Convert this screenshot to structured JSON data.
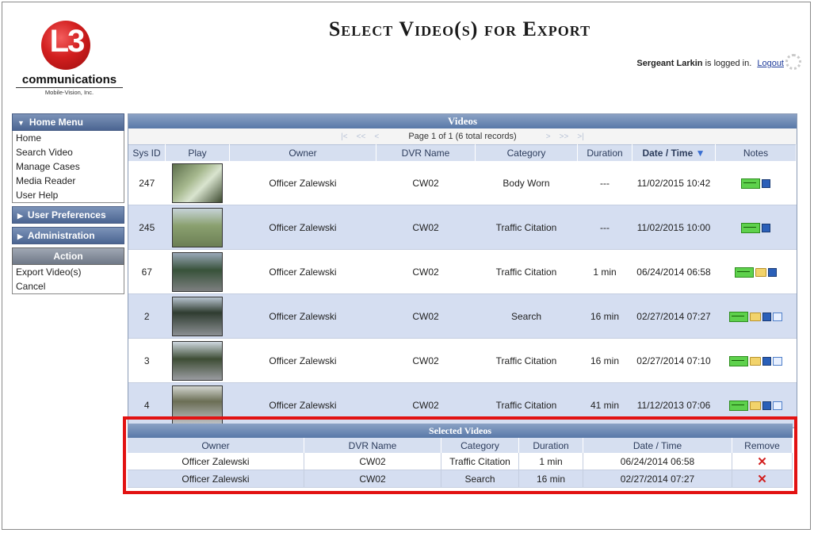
{
  "header": {
    "title": "Select Video(s) for Export",
    "user_name": "Sergeant Larkin",
    "logged_in_text": "is logged in.",
    "logout_label": "Logout"
  },
  "logo": {
    "mark": "L3",
    "name": "communications",
    "sub": "Mobile-Vision, Inc."
  },
  "sidebar": {
    "home_menu": "Home Menu",
    "items": [
      "Home",
      "Search Video",
      "Manage Cases",
      "Media Reader",
      "User Help"
    ],
    "user_preferences": "User Preferences",
    "administration": "Administration",
    "action": "Action",
    "actions": [
      "Export Video(s)",
      "Cancel"
    ]
  },
  "videos": {
    "title": "Videos",
    "pager_text": "Page 1 of 1 (6 total records)",
    "columns": [
      "Sys ID",
      "Play",
      "Owner",
      "DVR Name",
      "Category",
      "Duration",
      "Date / Time",
      "Notes"
    ],
    "sort_indicator": "▼",
    "rows": [
      {
        "sys_id": "247",
        "owner": "Officer Zalewski",
        "dvr": "CW02",
        "category": "Body Worn",
        "duration": "---",
        "datetime": "11/02/2015 10:42"
      },
      {
        "sys_id": "245",
        "owner": "Officer Zalewski",
        "dvr": "CW02",
        "category": "Traffic Citation",
        "duration": "---",
        "datetime": "11/02/2015 10:00"
      },
      {
        "sys_id": "67",
        "owner": "Officer Zalewski",
        "dvr": "CW02",
        "category": "Traffic Citation",
        "duration": "1 min",
        "datetime": "06/24/2014 06:58"
      },
      {
        "sys_id": "2",
        "owner": "Officer Zalewski",
        "dvr": "CW02",
        "category": "Search",
        "duration": "16 min",
        "datetime": "02/27/2014 07:27"
      },
      {
        "sys_id": "3",
        "owner": "Officer Zalewski",
        "dvr": "CW02",
        "category": "Traffic Citation",
        "duration": "16 min",
        "datetime": "02/27/2014 07:10"
      },
      {
        "sys_id": "4",
        "owner": "Officer Zalewski",
        "dvr": "CW02",
        "category": "Traffic Citation",
        "duration": "41 min",
        "datetime": "11/12/2013 07:06"
      }
    ]
  },
  "selected": {
    "title": "Selected Videos",
    "columns": [
      "Owner",
      "DVR Name",
      "Category",
      "Duration",
      "Date / Time",
      "Remove"
    ],
    "rows": [
      {
        "owner": "Officer Zalewski",
        "dvr": "CW02",
        "category": "Traffic Citation",
        "duration": "1 min",
        "datetime": "06/24/2014 06:58",
        "remove": "✕"
      },
      {
        "owner": "Officer Zalewski",
        "dvr": "CW02",
        "category": "Search",
        "duration": "16 min",
        "datetime": "02/27/2014 07:27",
        "remove": "✕"
      }
    ]
  }
}
